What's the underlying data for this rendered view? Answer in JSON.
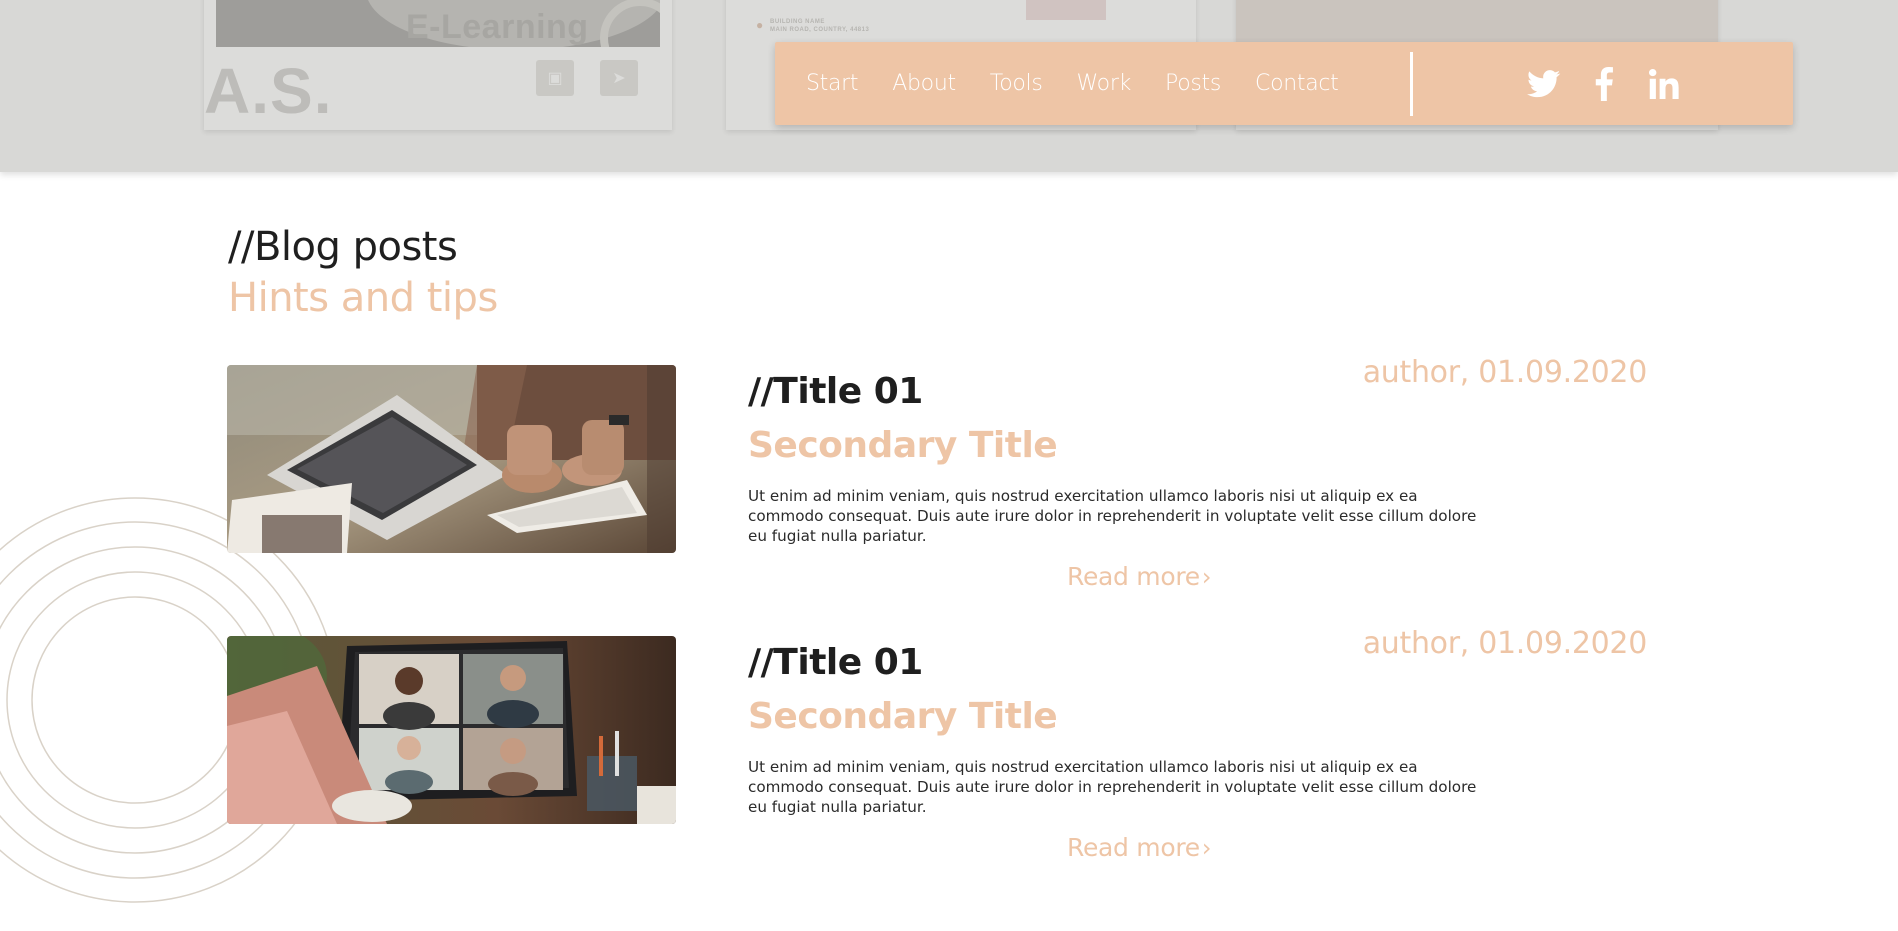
{
  "background_cards": {
    "card1_thumb_text": "E-Learning",
    "card1_initials": "A.S.",
    "card2_address": [
      "BUILDING NAME",
      "MAIN ROAD, COUNTRY, 44813"
    ]
  },
  "nav": {
    "links": [
      "Start",
      "About",
      "Tools",
      "Work",
      "Posts",
      "Contact"
    ],
    "social_icons": [
      "twitter-icon",
      "facebook-icon",
      "linkedin-icon"
    ],
    "background_color": "#eec5a6"
  },
  "blog": {
    "heading": "//Blog posts",
    "subheading": "Hints and tips",
    "posts": [
      {
        "title": "//Title 01",
        "subtitle": "Secondary Title",
        "meta": "author, 01.09.2020",
        "body": "Ut enim ad minim veniam, quis nostrud exercitation ullamco laboris nisi ut aliquip ex ea commodo consequat. Duis aute irure dolor in reprehenderit in voluptate velit esse cillum dolore eu fugiat nulla pariatur.",
        "read_more": "Read more",
        "image": "laptop-keyboard-desk-photo"
      },
      {
        "title": "//Title 01",
        "subtitle": "Secondary Title",
        "meta": "author, 01.09.2020",
        "body": "Ut enim ad minim veniam, quis nostrud exercitation ullamco laboris nisi ut aliquip ex ea commodo consequat. Duis aute irure dolor in reprehenderit in voluptate velit esse cillum dolore eu fugiat nulla pariatur.",
        "read_more": "Read more",
        "image": "video-call-laptop-photo"
      }
    ]
  },
  "colors": {
    "accent": "#eec5a6",
    "heading_text": "#1f1f1f",
    "top_overlay": "#d8d8d6",
    "decor_circles": "#d9d2c8"
  }
}
